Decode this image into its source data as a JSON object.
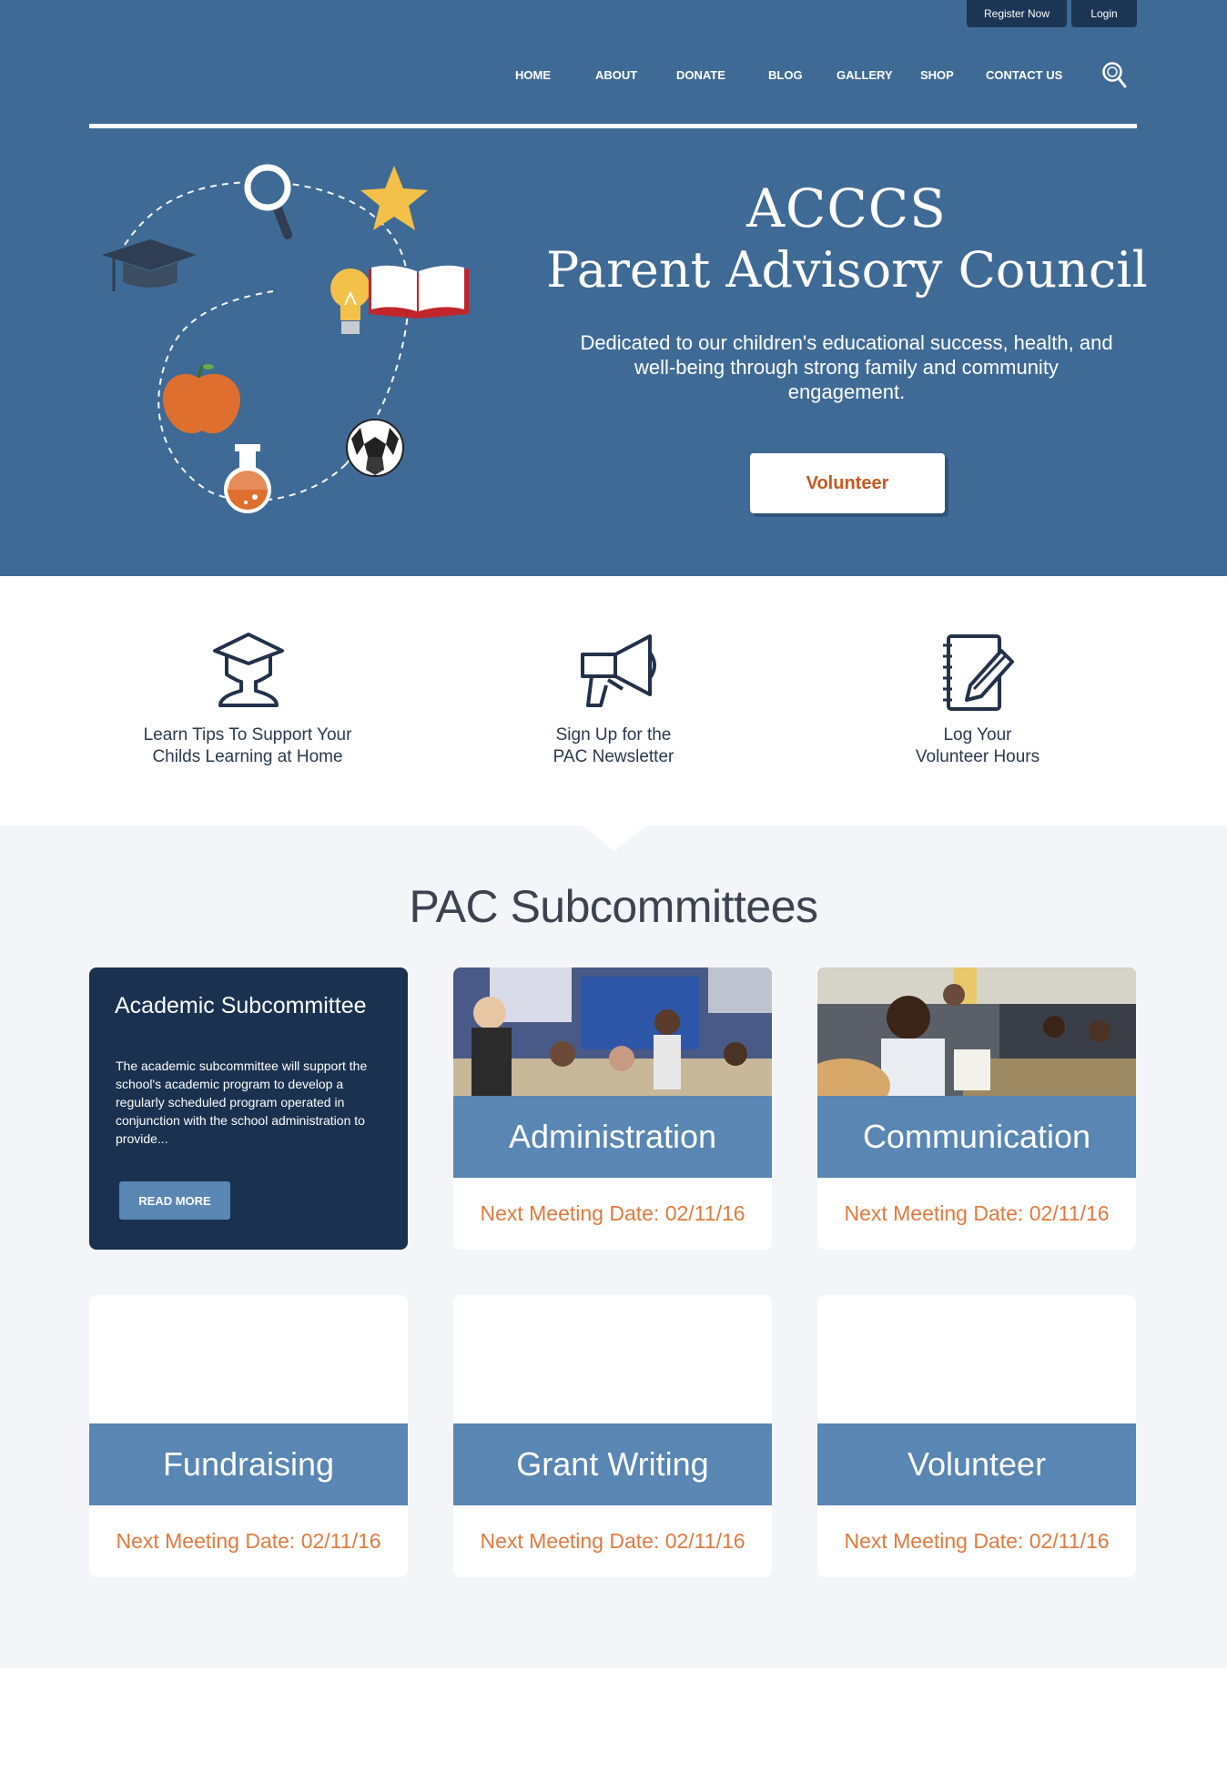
{
  "top_bar": {
    "register": "Register Now",
    "login": "Login"
  },
  "nav": {
    "items": [
      "HOME",
      "ABOUT",
      "DONATE",
      "BLOG",
      "GALLERY",
      "SHOP",
      "CONTACT US"
    ],
    "search_icon": "search-icon"
  },
  "hero": {
    "title_line1": "ACCCS",
    "title_line2": "Parent Advisory Council",
    "subtitle": "Dedicated to our children's educational success, health, and well-being through strong family and community engagement.",
    "cta": "Volunteer",
    "illustration_icons": [
      "graduation-cap-icon",
      "magnifier-icon",
      "star-icon",
      "lightbulb-icon",
      "open-book-icon",
      "apple-icon",
      "flask-icon",
      "soccer-ball-icon"
    ]
  },
  "quick_links": [
    {
      "icon": "graduate-icon",
      "line1": "Learn Tips To Support Your",
      "line2": "Childs Learning at Home"
    },
    {
      "icon": "megaphone-icon",
      "line1": "Sign Up for the",
      "line2": "PAC Newsletter"
    },
    {
      "icon": "notepad-pencil-icon",
      "line1": "Log Your",
      "line2": "Volunteer Hours"
    }
  ],
  "subcommittees": {
    "title": "PAC Subcommittees",
    "featured": {
      "title": "Academic Subcommittee",
      "text": "The academic subcommittee will support the school's academic program to develop a regularly scheduled program operated in conjunction with the school administration to provide...",
      "button": "READ MORE"
    },
    "cards": [
      {
        "name": "Administration",
        "meeting": "Next Meeting Date: 02/11/16"
      },
      {
        "name": "Communication",
        "meeting": "Next Meeting Date: 02/11/16"
      },
      {
        "name": "Fundraising",
        "meeting": "Next Meeting Date: 02/11/16"
      },
      {
        "name": "Grant Writing",
        "meeting": "Next Meeting Date: 02/11/16"
      },
      {
        "name": "Volunteer",
        "meeting": "Next Meeting Date: 02/11/16"
      }
    ]
  },
  "colors": {
    "hero_bg": "#3f6a95",
    "top_button_bg": "#1d3554",
    "featured_bg": "#1a314f",
    "band_blue": "#5986b3",
    "meeting_orange": "#e07a3f",
    "cta_orange": "#c8581f",
    "section_bg": "#f3f5f8"
  }
}
